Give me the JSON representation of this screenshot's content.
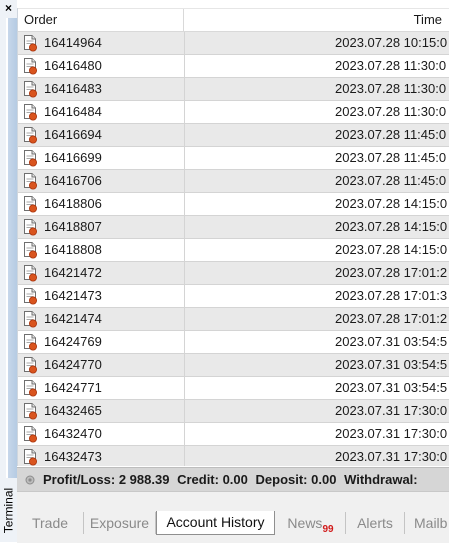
{
  "panel": {
    "close_glyph": "×",
    "side_label": "Terminal"
  },
  "table": {
    "columns": [
      "Order",
      "Time"
    ],
    "rows": [
      {
        "order": "16414964",
        "time": "2023.07.28 10:15:0"
      },
      {
        "order": "16416480",
        "time": "2023.07.28 11:30:0"
      },
      {
        "order": "16416483",
        "time": "2023.07.28 11:30:0"
      },
      {
        "order": "16416484",
        "time": "2023.07.28 11:30:0"
      },
      {
        "order": "16416694",
        "time": "2023.07.28 11:45:0"
      },
      {
        "order": "16416699",
        "time": "2023.07.28 11:45:0"
      },
      {
        "order": "16416706",
        "time": "2023.07.28 11:45:0"
      },
      {
        "order": "16418806",
        "time": "2023.07.28 14:15:0"
      },
      {
        "order": "16418807",
        "time": "2023.07.28 14:15:0"
      },
      {
        "order": "16418808",
        "time": "2023.07.28 14:15:0"
      },
      {
        "order": "16421472",
        "time": "2023.07.28 17:01:2"
      },
      {
        "order": "16421473",
        "time": "2023.07.28 17:01:3"
      },
      {
        "order": "16421474",
        "time": "2023.07.28 17:01:2"
      },
      {
        "order": "16424769",
        "time": "2023.07.31 03:54:5"
      },
      {
        "order": "16424770",
        "time": "2023.07.31 03:54:5"
      },
      {
        "order": "16424771",
        "time": "2023.07.31 03:54:5"
      },
      {
        "order": "16432465",
        "time": "2023.07.31 17:30:0"
      },
      {
        "order": "16432470",
        "time": "2023.07.31 17:30:0"
      },
      {
        "order": "16432473",
        "time": "2023.07.31 17:30:0"
      }
    ],
    "row_icon": "order-document-icon"
  },
  "summary": {
    "profit_loss": "Profit/Loss: 2 988.39",
    "credit": "Credit: 0.00",
    "deposit": "Deposit: 0.00",
    "withdrawal": "Withdrawal:"
  },
  "tabs": [
    {
      "label": "Trade"
    },
    {
      "label": "Exposure"
    },
    {
      "label": "Account History",
      "active": true
    },
    {
      "label": "News",
      "badge": "99"
    },
    {
      "label": "Alerts"
    },
    {
      "label": "Mailb"
    }
  ],
  "colors": {
    "row_alt": "#e9e9e9",
    "summary_bg": "#d6d6d6",
    "badge": "#d11a1a",
    "side_strip": "#b5cbe3"
  }
}
